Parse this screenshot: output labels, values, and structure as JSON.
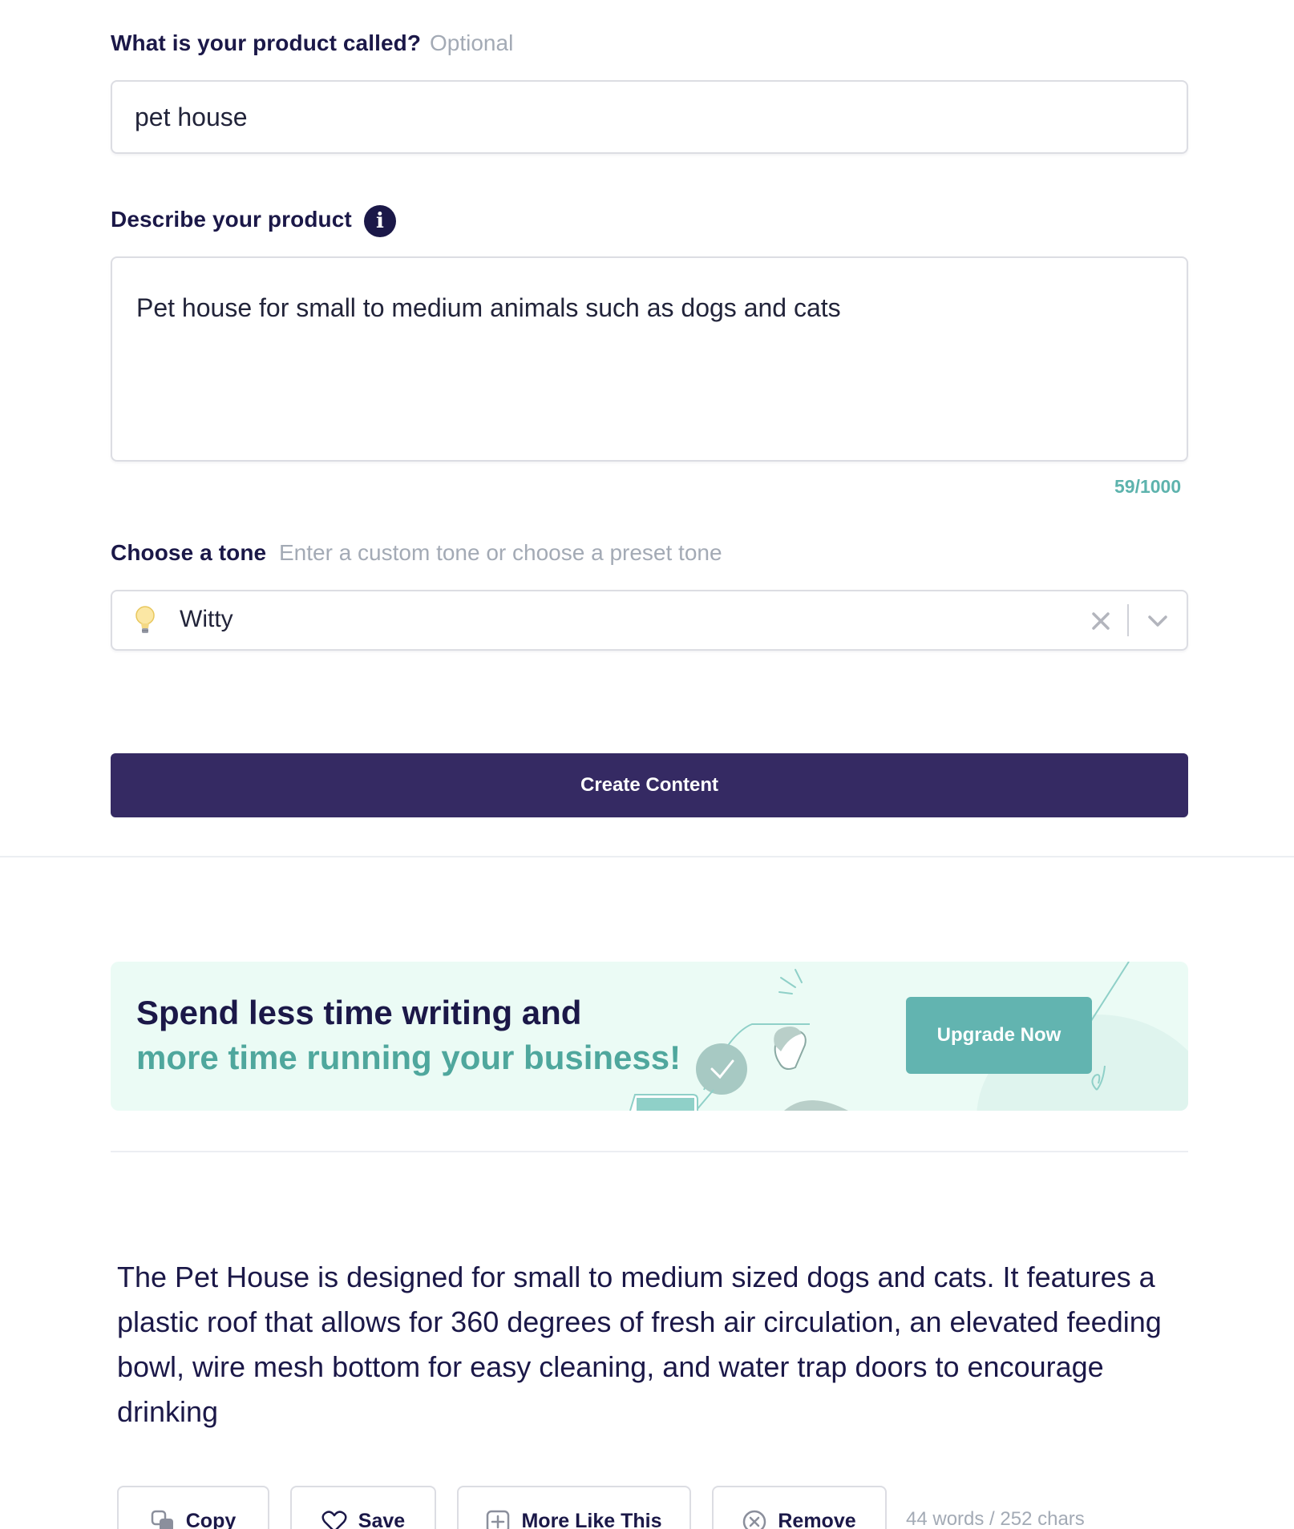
{
  "product_name": {
    "label": "What is your product called?",
    "hint": "Optional",
    "value": "pet house"
  },
  "description": {
    "label": "Describe your product",
    "info_icon": "info-icon",
    "value": "Pet house for small to medium animals such as dogs and cats",
    "counter": "59/1000"
  },
  "tone": {
    "label": "Choose a tone",
    "hint": "Enter a custom tone or choose a preset tone",
    "value": "Witty",
    "icon": "lightbulb-icon",
    "clear_icon": "close-icon",
    "dropdown_icon": "chevron-down-icon"
  },
  "create_button": "Create Content",
  "banner": {
    "line1": "Spend less time writing and",
    "line2": "more time running your business!",
    "button": "Upgrade Now"
  },
  "result": {
    "text": "The Pet House is designed for small to medium sized dogs and cats. It features a plastic roof that allows for 360 degrees of fresh air circulation, an elevated feeding bowl, wire mesh bottom for easy cleaning, and water trap doors to encourage drinking",
    "actions": {
      "copy": "Copy",
      "save": "Save",
      "more": "More Like This",
      "remove": "Remove"
    },
    "stats": "44 words / 252 chars"
  },
  "colors": {
    "primary": "#352a63",
    "accent": "#62b4b0",
    "counter": "#5db3ad",
    "banner_bg": "#ebfbf5"
  }
}
